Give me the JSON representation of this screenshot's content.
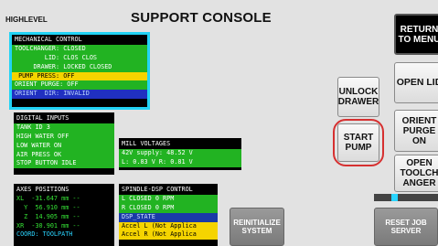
{
  "header": {
    "level": "HIGHLEVEL",
    "title": "SUPPORT CONSOLE"
  },
  "mechanical": {
    "title": "MECHANICAL CONTROL",
    "rows": [
      "TOOLCHANGER: CLOSED",
      "        LID: CLOS CLOS",
      "     DRAWER: LOCKED CLOSED",
      " PUMP PRESS: OFF",
      "ORIENT PURGE: OFF",
      "ORIENT  DIR: INVALID"
    ]
  },
  "digital": {
    "title": "DIGITAL INPUTS",
    "rows": [
      "TANK ID 3",
      "HIGH WATER OFF",
      "LOW WATER ON",
      "AIR PRESS OK",
      "STOP BUTTON IDLE"
    ]
  },
  "voltages": {
    "title": "MILL VOLTAGES",
    "rows": [
      "42V supply: 48.52 V",
      "L: 0.83 V R: 0.81 V"
    ]
  },
  "axes": {
    "title": "AXES POSITIONS",
    "rows": [
      "XL  -31.647 mm --",
      "  Y  56.910 mm --",
      "  Z  14.905 mm --",
      "XR  -30.901 mm --",
      "COORD: TOOLPATH"
    ]
  },
  "spindle": {
    "title": "SPINDLE-DSP CONTROL",
    "rows": [
      "L CLOSED 0 RPM",
      "R CLOSED 0 RPM",
      "DSP_STATE",
      "Accel L (Not Applica",
      "Accel R (Not Applica"
    ]
  },
  "buttons": {
    "return_menu": "RETURN TO MENU",
    "open_lid": "OPEN LID",
    "unlock_drawer": "UNLOCK DRAWER",
    "orient_purge": "ORIENT PURGE ON",
    "start_pump": "START PUMP",
    "open_toolchanger": "OPEN TOOLCH ANGER",
    "reinitialize": "REINITIALIZE SYSTEM",
    "reset_job": "RESET JOB SERVER"
  },
  "colors": {
    "accent_border": "#22d3f5",
    "highlight": "#f5d400",
    "status_green": "#22b322",
    "start_pump_circle": "#d63030"
  },
  "slider": {
    "level": 0.3
  }
}
